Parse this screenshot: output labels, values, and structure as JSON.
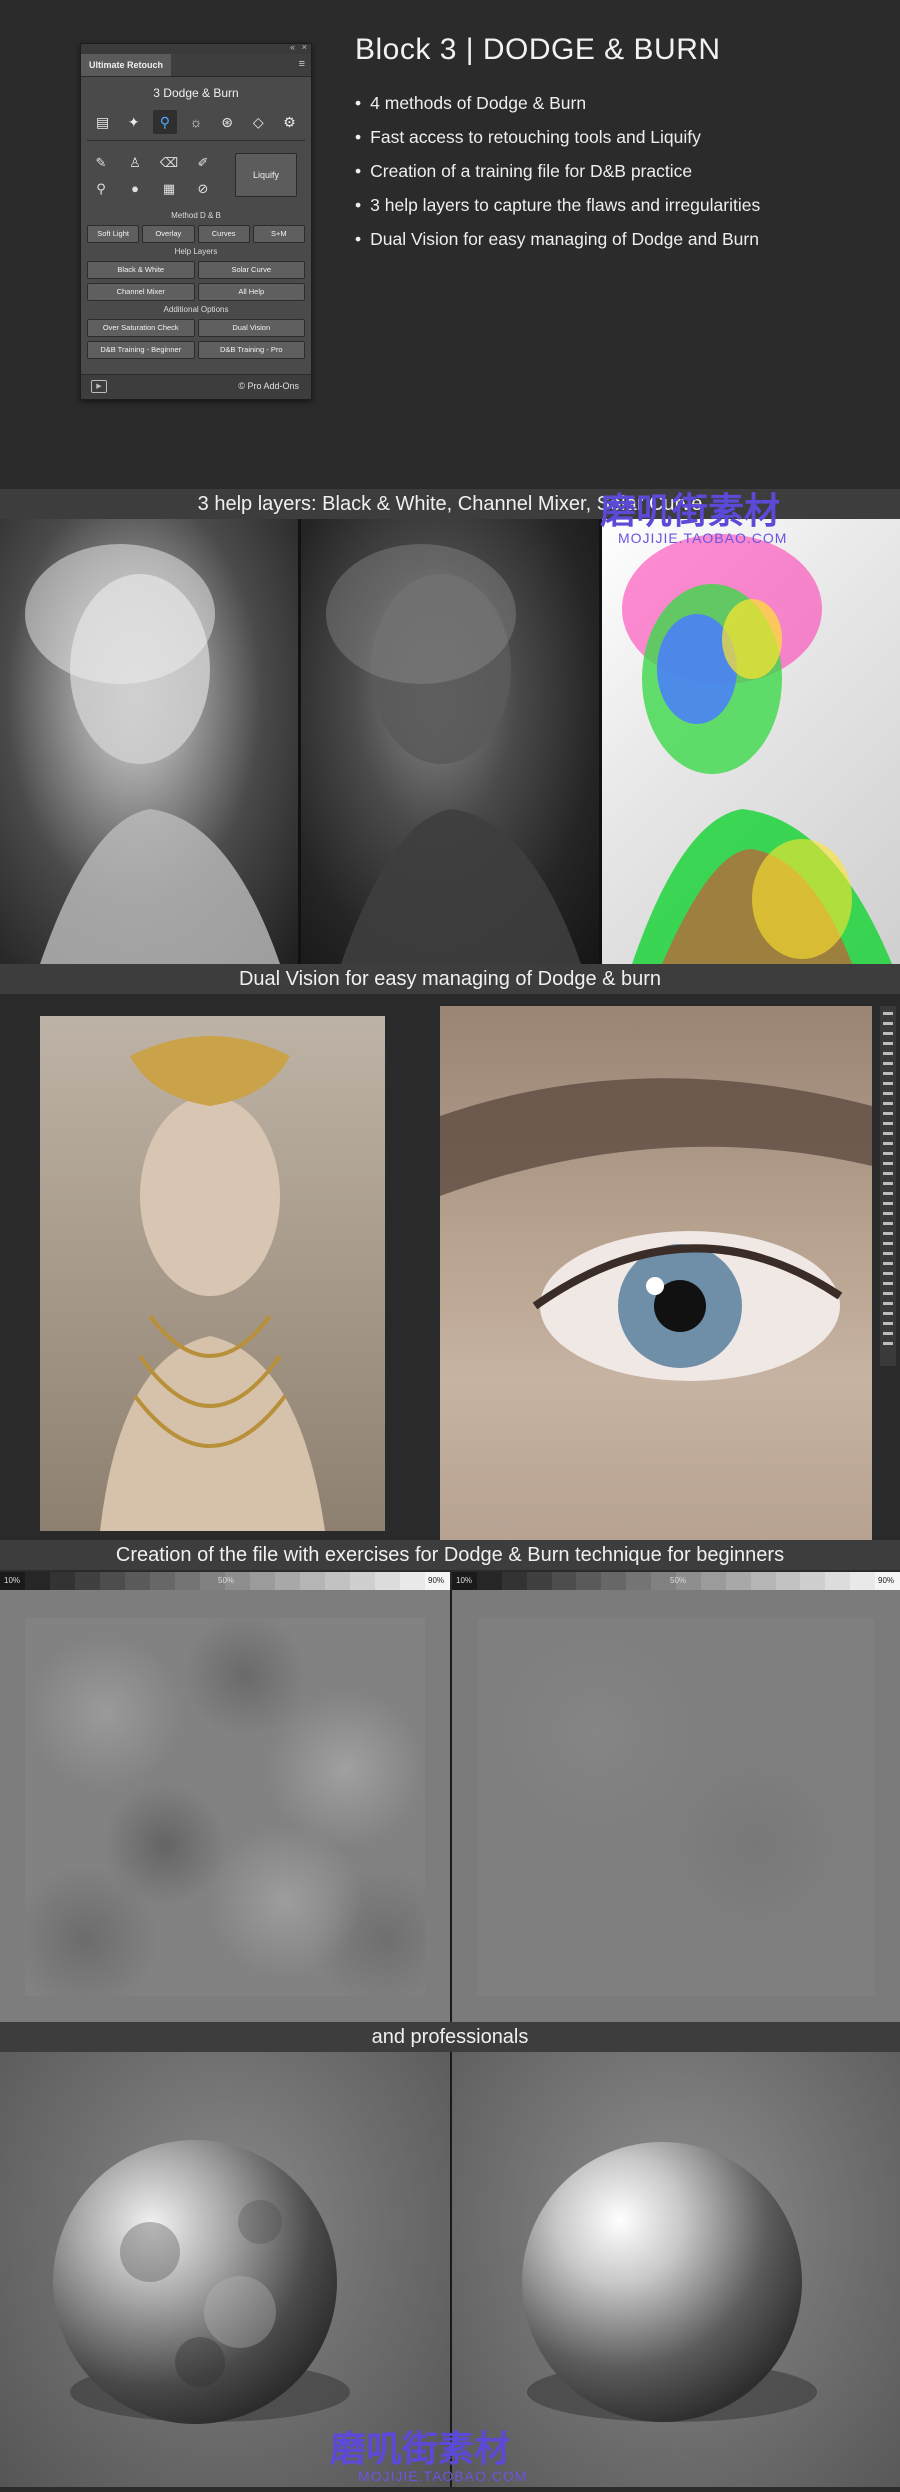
{
  "panel": {
    "collapse_glyph": "«",
    "close_glyph": "×",
    "tab_label": "Ultimate Retouch",
    "menu_icon": "menu-icon",
    "title": "3 Dodge & Burn",
    "top_icons": [
      "document-icon",
      "sparkle-icon",
      "magnifier-icon",
      "sun-icon",
      "circles-icon",
      "diamond-icon",
      "gears-icon"
    ],
    "tool_icons": [
      "brush-icon",
      "stamp-icon",
      "eraser-icon",
      "pencil-icon",
      "zoom-icon",
      "blob-icon",
      "grid-icon",
      "bandage-icon"
    ],
    "liquify_label": "Liquify",
    "method_heading": "Method D & B",
    "method_buttons": [
      "Soft Light",
      "Overlay",
      "Curves",
      "S+M"
    ],
    "help_heading": "Help Layers",
    "help_buttons": [
      [
        "Black & White",
        "Solar Curve"
      ],
      [
        "Channel Mixer",
        "All Help"
      ]
    ],
    "options_heading": "Additional Options",
    "options_buttons": [
      [
        "Over Saturation Check",
        "Dual Vision"
      ],
      [
        "D&B Training - Beginner",
        "D&B Training - Pro"
      ]
    ],
    "footer_icon": "video-icon",
    "footer_copyright": "© Pro Add-Ons"
  },
  "header": {
    "title": "Block 3 | DODGE & BURN",
    "features": [
      "4 methods of Dodge & Burn",
      "Fast access to retouching tools and Liquify",
      "Creation of a training file for D&B practice",
      "3 help layers to capture the flaws and irregularities",
      "Dual Vision for easy managing of Dodge and Burn"
    ]
  },
  "sections": {
    "help_layers": "3 help layers: Black & White, Channel Mixer, Solar Curve",
    "dual_vision": "Dual Vision for easy managing of Dodge & burn",
    "exercises": "Creation of the file with exercises for Dodge & Burn technique for beginners",
    "professionals": "and professionals"
  },
  "gradient_strip": {
    "left_label": "10%",
    "mid_label": "50%",
    "right_label": "90%"
  },
  "watermark": {
    "main": "磨叽街素材",
    "sub": "MOJIJIE.TAOBAO.COM"
  },
  "colors": {
    "background": "#2b2b2b",
    "section_bar": "#3d3d3d",
    "accent_icon": "#4fa9ff",
    "watermark": "#5b49d8"
  }
}
